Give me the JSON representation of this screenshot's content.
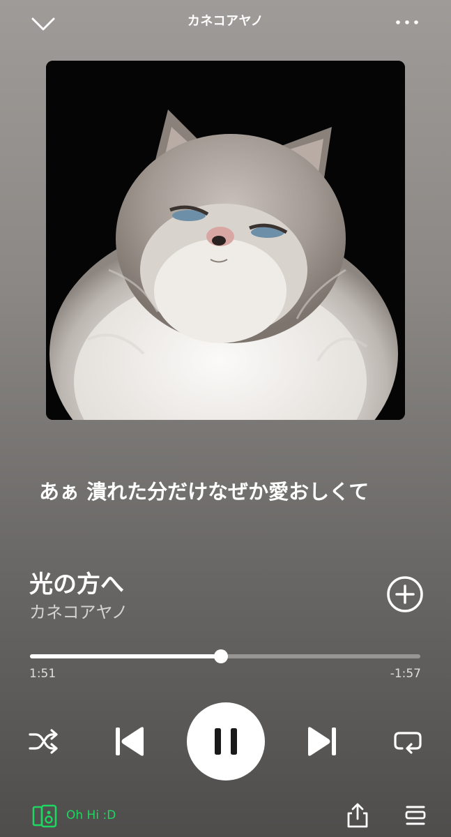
{
  "header": {
    "title": "カネコアヤノ",
    "collapse_icon": "chevron-down-icon",
    "more_icon": "more-horizontal-icon"
  },
  "artwork": {
    "subject": "fluffy grey and white cat on black background"
  },
  "lyrics": {
    "current_line": "あぁ 潰れた分だけなぜか愛おしくて"
  },
  "track": {
    "title": "光の方へ",
    "artist": "カネコアヤノ",
    "add_icon": "plus-circle-icon"
  },
  "progress": {
    "elapsed": "1:51",
    "remaining": "-1:57",
    "fraction": 0.489
  },
  "controls": {
    "shuffle_icon": "shuffle-icon",
    "previous_icon": "skip-previous-icon",
    "pause_icon": "pause-icon",
    "next_icon": "skip-next-icon",
    "repeat_icon": "repeat-icon"
  },
  "footer": {
    "device_icon": "connect-device-icon",
    "device_name": "Oh Hi :D",
    "share_icon": "share-icon",
    "queue_icon": "queue-icon"
  },
  "colors": {
    "accent_green": "#1ed760",
    "background_top": "#9f9b98",
    "background_bottom": "#4e4d4c"
  }
}
